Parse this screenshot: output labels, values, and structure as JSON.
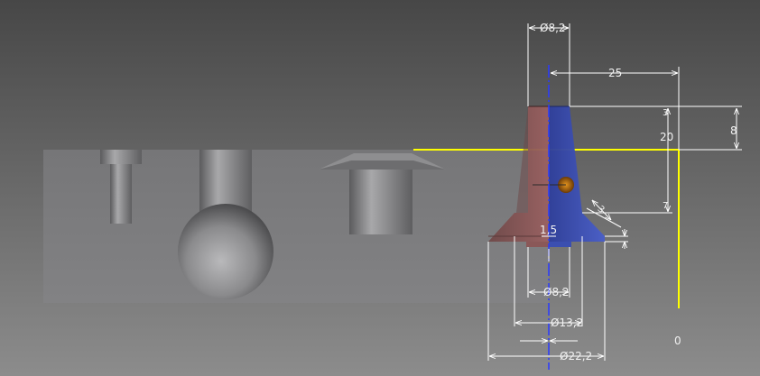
{
  "viewport": {
    "background_top": "#4a4a4a",
    "background_bottom": "#8a8a8a"
  },
  "colors": {
    "part_body": "#7c7c7e",
    "cone_red": "#8a5858",
    "cone_blue": "#3b4fb0",
    "sketch_line": "#ffff00",
    "centerline": "#2a3aff",
    "dimension": "#ffffff",
    "hole_orange": "#c86a10"
  },
  "dimensions": {
    "top_dia": "Ø8,2",
    "top_offset": "25",
    "height_total": "20",
    "depth_8": "8",
    "small_3": "3",
    "small_7": "7",
    "flange_1_5": "1,5",
    "chamfer_3": "3",
    "bottom_dia_small": "Ø8,2",
    "bottom_dia_mid": "Ø13,2",
    "bottom_dia_large": "Ø22,2"
  },
  "origin_label": "0"
}
